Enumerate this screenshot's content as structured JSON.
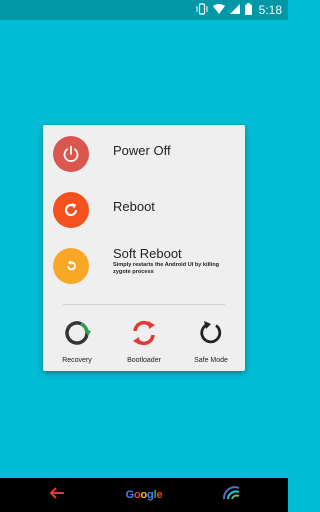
{
  "status": {
    "time": "5:18"
  },
  "menu": {
    "power_off": "Power Off",
    "reboot": "Reboot",
    "soft_reboot": "Soft Reboot",
    "soft_reboot_desc": "Simply restarts the Android UI by killing zygote process"
  },
  "bottom": {
    "recovery": "Recovery",
    "bootloader": "Bootloader",
    "safe_mode": "Safe Mode"
  },
  "nav": {
    "google_logo_text": "Google"
  },
  "colors": {
    "background": "#00bcd4",
    "power_off": "#d9574f",
    "reboot": "#f4511e",
    "soft_reboot": "#f9a825",
    "recovery_green": "#2e9e4a",
    "bootloader_red": "#e53935"
  }
}
